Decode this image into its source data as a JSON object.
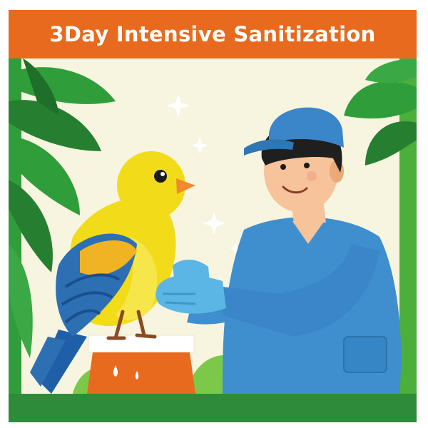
{
  "banner": {
    "title": "3Day Intensive Sanitization",
    "background_color": "#e86a1e",
    "text_color": "#ffffff"
  },
  "illustration": {
    "subjects": [
      "yellow-bird",
      "veterinary-worker",
      "gloves",
      "sanitizing-sparkles",
      "orange-pedestal",
      "jungle-leaves"
    ],
    "colors": {
      "bird": "#f2dc1a",
      "bird_wing": "#2d6fb3",
      "uniform": "#3f8fcf",
      "gloves": "#5bb6e6",
      "cap": "#3a86c8",
      "pedestal": "#e86a1e",
      "foliage": "#2f9e3a",
      "background": "#f7f5df"
    }
  }
}
